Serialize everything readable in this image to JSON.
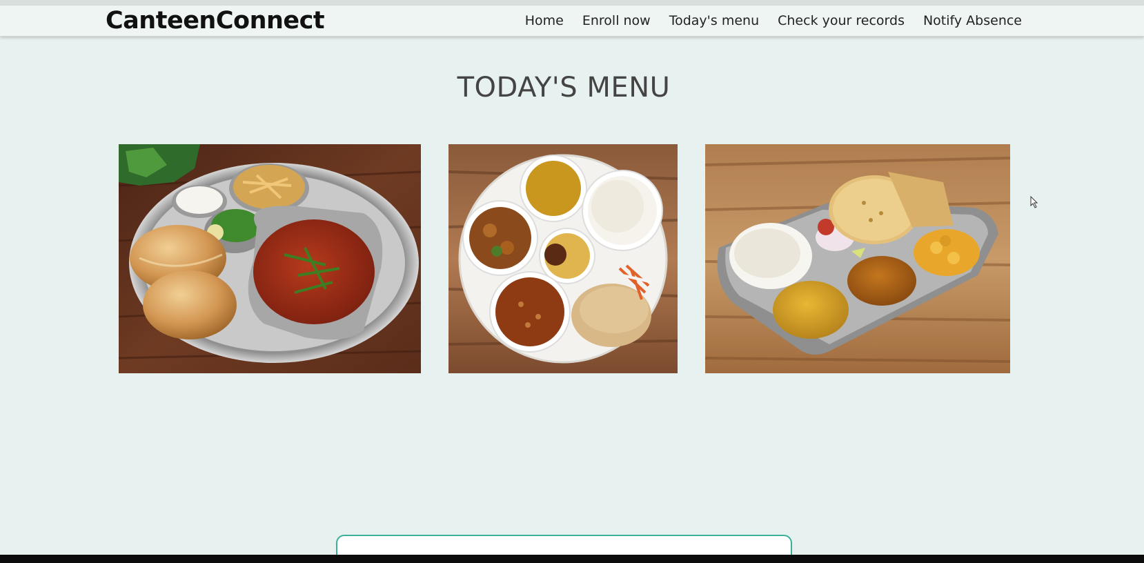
{
  "brand": {
    "name": "CanteenConnect"
  },
  "nav": {
    "items": [
      {
        "label": "Home"
      },
      {
        "label": "Enroll now"
      },
      {
        "label": "Today's menu"
      },
      {
        "label": "Check your records"
      },
      {
        "label": "Notify Absence"
      }
    ]
  },
  "page": {
    "title": "TODAY'S MENU"
  },
  "menu": {
    "items": [
      {
        "icon": "misal-pav-plate-image"
      },
      {
        "icon": "round-thali-image"
      },
      {
        "icon": "rectangular-thali-image"
      }
    ]
  },
  "colors": {
    "background": "#e7f1ef",
    "navbar": "#eef5f3",
    "accent": "#3daf97",
    "wood": "#6b3a22"
  }
}
